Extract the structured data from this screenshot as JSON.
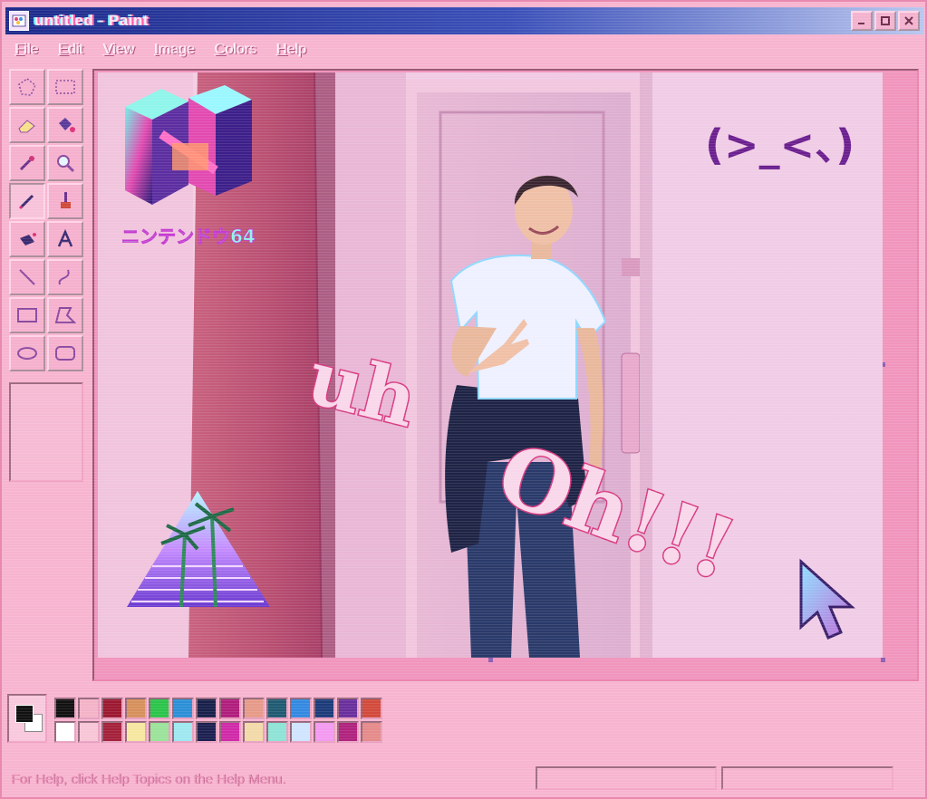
{
  "window": {
    "title": "untitled - Paint",
    "icon": "paint-icon",
    "controls": [
      "minimize",
      "maximize",
      "close"
    ]
  },
  "menu": [
    "File",
    "Edit",
    "View",
    "Image",
    "Colors",
    "Help"
  ],
  "tools": [
    "free-select",
    "rect-select",
    "eraser",
    "fill-bucket",
    "eyedropper",
    "magnifier",
    "pencil",
    "brush",
    "airbrush",
    "text",
    "line",
    "curve",
    "rectangle",
    "polygon",
    "ellipse",
    "rounded-rectangle"
  ],
  "active_tool": "pencil",
  "canvas": {
    "logo_caption": "ニンテンドウ64",
    "emoticon": "(>_<、)",
    "overlay_words": [
      "uh",
      "Oh!!!"
    ]
  },
  "palette": {
    "foreground": "#111111",
    "background": "#ffffff",
    "top_row": [
      "#111111",
      "#f3b3c7",
      "#9c1830",
      "#d6905c",
      "#2bc44a",
      "#2c8fd6",
      "#18204a",
      "#b01e7c",
      "#e69a88",
      "#1f5a72",
      "#3389e0",
      "#1c3b7a",
      "#6a2f9c",
      "#d24a3c"
    ],
    "bottom_row": [
      "#ffffff",
      "#f7c6d6",
      "#a4213a",
      "#f6e7a0",
      "#9be29a",
      "#9ee8f0",
      "#1c2050",
      "#d02aa8",
      "#f2d9a8",
      "#8de3d6",
      "#cfe4ff",
      "#f39af0",
      "#b0237e",
      "#e58a8a"
    ]
  },
  "status": {
    "help_text": "For Help, click Help Topics on the Help Menu."
  }
}
